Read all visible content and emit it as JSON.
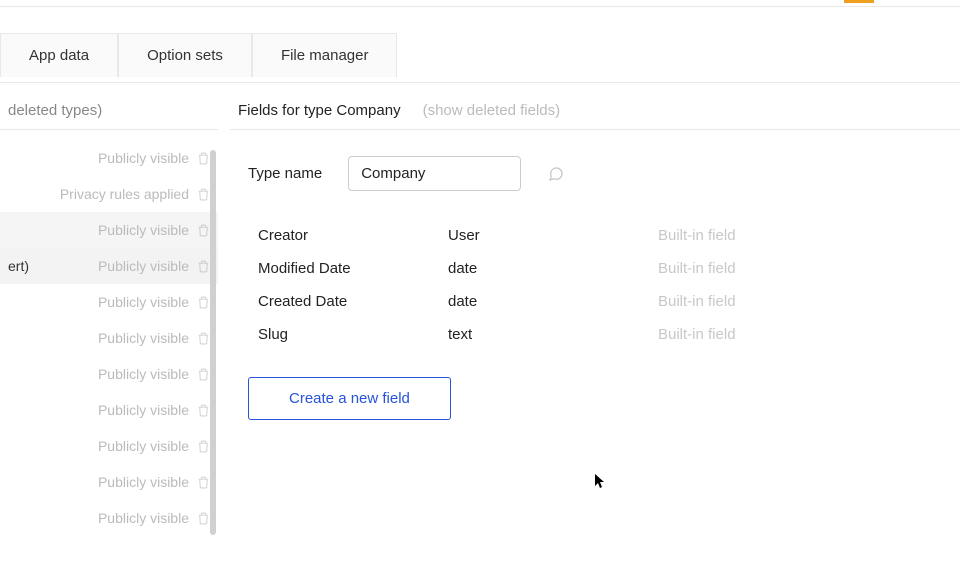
{
  "topTabs": {
    "appData": "App data",
    "optionSets": "Option sets",
    "fileManager": "File manager"
  },
  "sidebar": {
    "headerSuffix": "deleted types)",
    "items": [
      {
        "visibility": "Publicly visible",
        "name": ""
      },
      {
        "visibility": "Privacy rules applied",
        "name": ""
      },
      {
        "visibility": "Publicly visible",
        "name": "",
        "selected": true
      },
      {
        "visibility": "Publicly visible",
        "name": "ert)"
      },
      {
        "visibility": "Publicly visible",
        "name": ""
      },
      {
        "visibility": "Publicly visible",
        "name": ""
      },
      {
        "visibility": "Publicly visible",
        "name": ""
      },
      {
        "visibility": "Publicly visible",
        "name": ""
      },
      {
        "visibility": "Publicly visible",
        "name": ""
      },
      {
        "visibility": "Publicly visible",
        "name": ""
      },
      {
        "visibility": "Publicly visible",
        "name": ""
      }
    ]
  },
  "main": {
    "title": "Fields for type Company",
    "showDeletedLabel": "(show deleted fields)",
    "typeNameLabel": "Type name",
    "typeNameValue": "Company",
    "fields": [
      {
        "name": "Creator",
        "type": "User",
        "builtin": "Built-in field"
      },
      {
        "name": "Modified Date",
        "type": "date",
        "builtin": "Built-in field"
      },
      {
        "name": "Created Date",
        "type": "date",
        "builtin": "Built-in field"
      },
      {
        "name": "Slug",
        "type": "text",
        "builtin": "Built-in field"
      }
    ],
    "createFieldLabel": "Create a new field"
  }
}
